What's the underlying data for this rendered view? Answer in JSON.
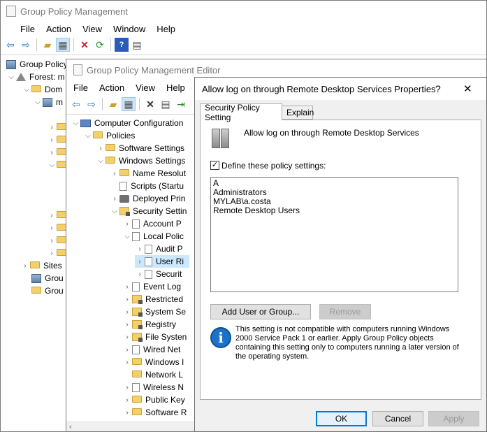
{
  "gpm": {
    "title": "Group Policy Management",
    "menu": [
      "File",
      "Action",
      "View",
      "Window",
      "Help"
    ],
    "tree": [
      {
        "label": "Group Policy"
      },
      {
        "label": "Forest: m"
      },
      {
        "label": "Dom"
      },
      {
        "label": "m"
      },
      {
        "label": "Sites"
      },
      {
        "label": "Grou"
      },
      {
        "label": "Grou"
      }
    ]
  },
  "gpme": {
    "title": "Group Policy Management Editor",
    "menu": [
      "File",
      "Action",
      "View",
      "Help"
    ],
    "tree": [
      {
        "label": "Computer Configuration"
      },
      {
        "label": "Policies"
      },
      {
        "label": "Software Settings"
      },
      {
        "label": "Windows Settings"
      },
      {
        "label": "Name Resolut"
      },
      {
        "label": "Scripts (Startu"
      },
      {
        "label": "Deployed Prin"
      },
      {
        "label": "Security Settin"
      },
      {
        "label": "Account P"
      },
      {
        "label": "Local Polic"
      },
      {
        "label": "Audit P"
      },
      {
        "label": "User Ri"
      },
      {
        "label": "Securit"
      },
      {
        "label": "Event Log"
      },
      {
        "label": "Restricted"
      },
      {
        "label": "System Se"
      },
      {
        "label": "Registry"
      },
      {
        "label": "File Systen"
      },
      {
        "label": "Wired Net"
      },
      {
        "label": "Windows I"
      },
      {
        "label": "Network L"
      },
      {
        "label": "Wireless N"
      },
      {
        "label": "Public Key"
      },
      {
        "label": "Software R"
      }
    ]
  },
  "dialog": {
    "title": "Allow log on through Remote Desktop Services Properties",
    "help_label": "?",
    "close_label": "✕",
    "tabs": [
      "Security Policy Setting",
      "Explain"
    ],
    "policy_name": "Allow log on through Remote Desktop Services",
    "define_label": "Define these policy settings:",
    "define_checked": true,
    "accounts": [
      "A",
      "Administrators",
      "MYLAB\\a.costa",
      "Remote Desktop Users"
    ],
    "add_button": "Add User or Group...",
    "remove_button": "Remove",
    "info_text": "This setting is not compatible with computers running Windows 2000 Service Pack 1 or earlier.  Apply Group Policy objects containing this setting only to computers running a later version of the operating system.",
    "ok_button": "OK",
    "cancel_button": "Cancel",
    "apply_button": "Apply"
  },
  "colors": {
    "accent": "#0078d7",
    "info_icon": "#1a73c8",
    "selected_row": "#cce8ff",
    "folder": "#f3d06b"
  }
}
